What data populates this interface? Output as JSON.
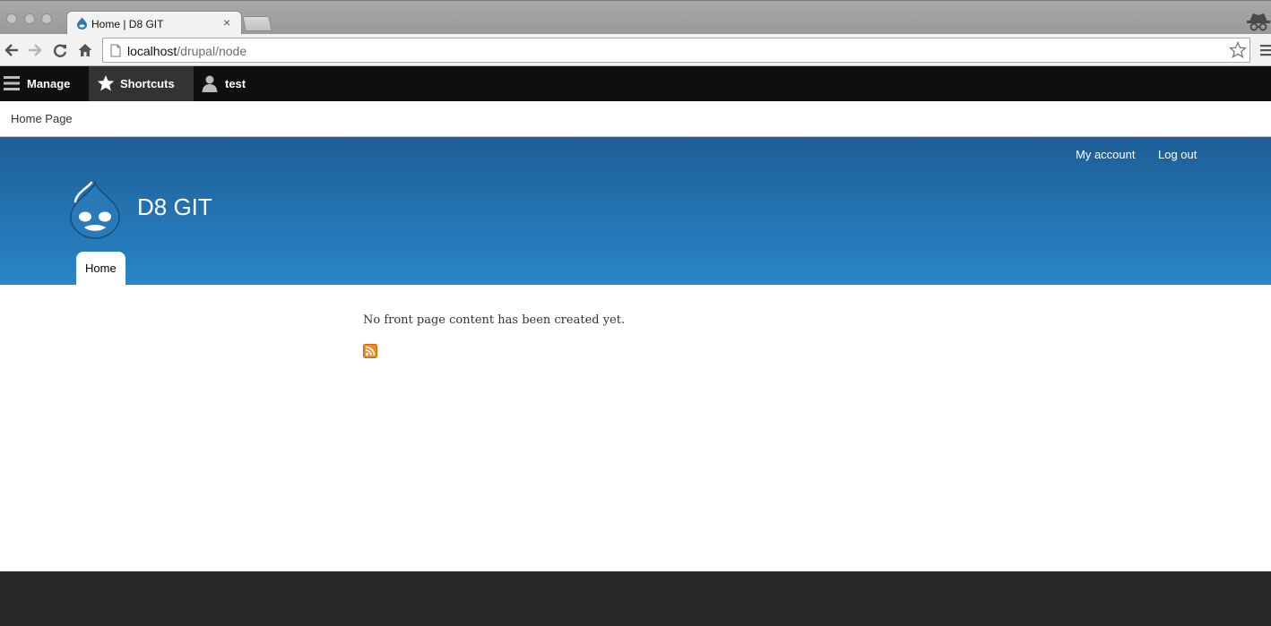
{
  "browser": {
    "tab_title": "Home | D8 GIT",
    "tab_close": "×",
    "url_host": "localhost",
    "url_path": "/drupal/node"
  },
  "admin_toolbar": {
    "manage": "Manage",
    "shortcuts": "Shortcuts",
    "user": "test",
    "tray_link": "Home Page"
  },
  "header": {
    "secondary_menu": [
      "My account",
      "Log out"
    ],
    "site_name": "D8 GIT",
    "primary_tab": "Home"
  },
  "content": {
    "message": "No front page content has been created yet."
  },
  "colors": {
    "header_top": "#1d5e97",
    "header_bottom": "#2a86c7",
    "admin_bar": "#0f0f0f",
    "footer": "#292929",
    "feed": "#f08a24"
  }
}
